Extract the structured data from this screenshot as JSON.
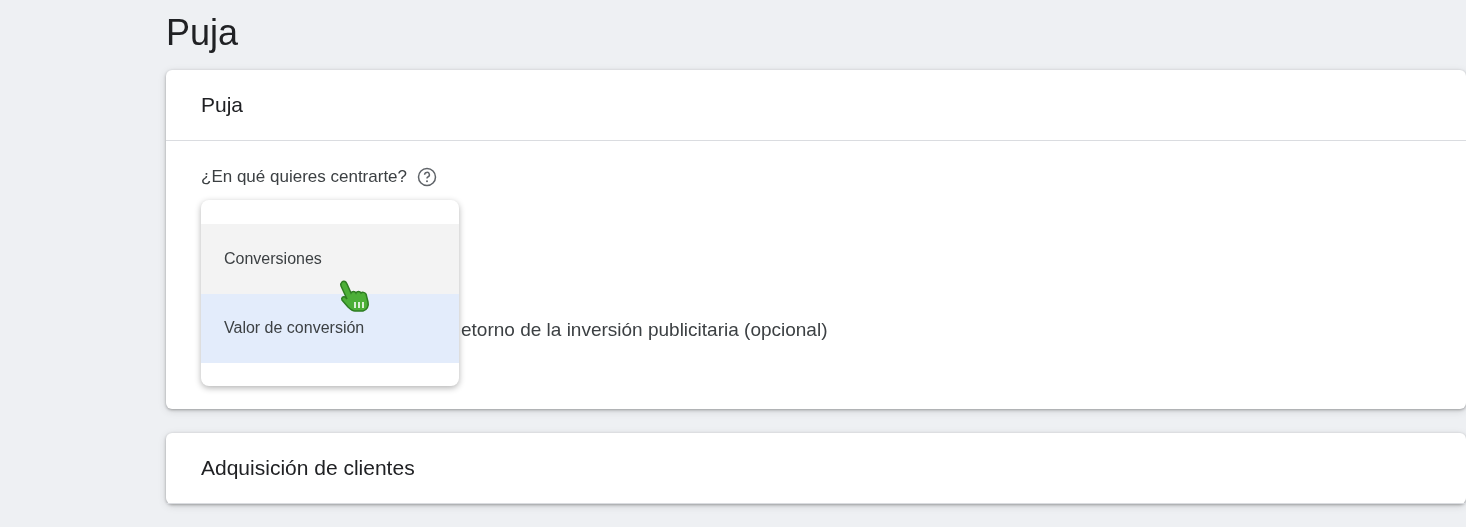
{
  "page_title": "Puja",
  "cards": [
    {
      "title": "Puja",
      "field_label": "¿En qué quieres centrarte?",
      "dropdown": {
        "options": [
          {
            "label": "Conversiones",
            "selected": false,
            "hovered": true
          },
          {
            "label": "Valor de conversión",
            "selected": true,
            "hovered": false
          }
        ]
      },
      "checkbox_label": "etorno de la inversión publicitaria (opcional)"
    },
    {
      "title": "Adquisición de clientes"
    }
  ]
}
